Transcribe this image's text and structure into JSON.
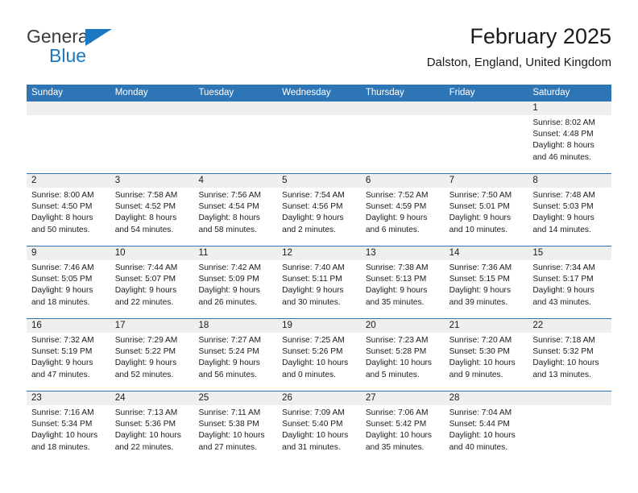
{
  "brand": {
    "line1": "General",
    "line2": "Blue",
    "triangle_color": "#1a78c2"
  },
  "header": {
    "title": "February 2025",
    "subtitle": "Dalston, England, United Kingdom"
  },
  "colors": {
    "header_blue": "#2e75b6",
    "day_band_gray": "#efefef",
    "text": "#1b1b1b"
  },
  "weekdays": [
    "Sunday",
    "Monday",
    "Tuesday",
    "Wednesday",
    "Thursday",
    "Friday",
    "Saturday"
  ],
  "weeks": [
    [
      {
        "day": "",
        "empty": true
      },
      {
        "day": "",
        "empty": true
      },
      {
        "day": "",
        "empty": true
      },
      {
        "day": "",
        "empty": true
      },
      {
        "day": "",
        "empty": true
      },
      {
        "day": "",
        "empty": true
      },
      {
        "day": "1",
        "sunrise": "Sunrise: 8:02 AM",
        "sunset": "Sunset: 4:48 PM",
        "daylight": "Daylight: 8 hours and 46 minutes."
      }
    ],
    [
      {
        "day": "2",
        "sunrise": "Sunrise: 8:00 AM",
        "sunset": "Sunset: 4:50 PM",
        "daylight": "Daylight: 8 hours and 50 minutes."
      },
      {
        "day": "3",
        "sunrise": "Sunrise: 7:58 AM",
        "sunset": "Sunset: 4:52 PM",
        "daylight": "Daylight: 8 hours and 54 minutes."
      },
      {
        "day": "4",
        "sunrise": "Sunrise: 7:56 AM",
        "sunset": "Sunset: 4:54 PM",
        "daylight": "Daylight: 8 hours and 58 minutes."
      },
      {
        "day": "5",
        "sunrise": "Sunrise: 7:54 AM",
        "sunset": "Sunset: 4:56 PM",
        "daylight": "Daylight: 9 hours and 2 minutes."
      },
      {
        "day": "6",
        "sunrise": "Sunrise: 7:52 AM",
        "sunset": "Sunset: 4:59 PM",
        "daylight": "Daylight: 9 hours and 6 minutes."
      },
      {
        "day": "7",
        "sunrise": "Sunrise: 7:50 AM",
        "sunset": "Sunset: 5:01 PM",
        "daylight": "Daylight: 9 hours and 10 minutes."
      },
      {
        "day": "8",
        "sunrise": "Sunrise: 7:48 AM",
        "sunset": "Sunset: 5:03 PM",
        "daylight": "Daylight: 9 hours and 14 minutes."
      }
    ],
    [
      {
        "day": "9",
        "sunrise": "Sunrise: 7:46 AM",
        "sunset": "Sunset: 5:05 PM",
        "daylight": "Daylight: 9 hours and 18 minutes."
      },
      {
        "day": "10",
        "sunrise": "Sunrise: 7:44 AM",
        "sunset": "Sunset: 5:07 PM",
        "daylight": "Daylight: 9 hours and 22 minutes."
      },
      {
        "day": "11",
        "sunrise": "Sunrise: 7:42 AM",
        "sunset": "Sunset: 5:09 PM",
        "daylight": "Daylight: 9 hours and 26 minutes."
      },
      {
        "day": "12",
        "sunrise": "Sunrise: 7:40 AM",
        "sunset": "Sunset: 5:11 PM",
        "daylight": "Daylight: 9 hours and 30 minutes."
      },
      {
        "day": "13",
        "sunrise": "Sunrise: 7:38 AM",
        "sunset": "Sunset: 5:13 PM",
        "daylight": "Daylight: 9 hours and 35 minutes."
      },
      {
        "day": "14",
        "sunrise": "Sunrise: 7:36 AM",
        "sunset": "Sunset: 5:15 PM",
        "daylight": "Daylight: 9 hours and 39 minutes."
      },
      {
        "day": "15",
        "sunrise": "Sunrise: 7:34 AM",
        "sunset": "Sunset: 5:17 PM",
        "daylight": "Daylight: 9 hours and 43 minutes."
      }
    ],
    [
      {
        "day": "16",
        "sunrise": "Sunrise: 7:32 AM",
        "sunset": "Sunset: 5:19 PM",
        "daylight": "Daylight: 9 hours and 47 minutes."
      },
      {
        "day": "17",
        "sunrise": "Sunrise: 7:29 AM",
        "sunset": "Sunset: 5:22 PM",
        "daylight": "Daylight: 9 hours and 52 minutes."
      },
      {
        "day": "18",
        "sunrise": "Sunrise: 7:27 AM",
        "sunset": "Sunset: 5:24 PM",
        "daylight": "Daylight: 9 hours and 56 minutes."
      },
      {
        "day": "19",
        "sunrise": "Sunrise: 7:25 AM",
        "sunset": "Sunset: 5:26 PM",
        "daylight": "Daylight: 10 hours and 0 minutes."
      },
      {
        "day": "20",
        "sunrise": "Sunrise: 7:23 AM",
        "sunset": "Sunset: 5:28 PM",
        "daylight": "Daylight: 10 hours and 5 minutes."
      },
      {
        "day": "21",
        "sunrise": "Sunrise: 7:20 AM",
        "sunset": "Sunset: 5:30 PM",
        "daylight": "Daylight: 10 hours and 9 minutes."
      },
      {
        "day": "22",
        "sunrise": "Sunrise: 7:18 AM",
        "sunset": "Sunset: 5:32 PM",
        "daylight": "Daylight: 10 hours and 13 minutes."
      }
    ],
    [
      {
        "day": "23",
        "sunrise": "Sunrise: 7:16 AM",
        "sunset": "Sunset: 5:34 PM",
        "daylight": "Daylight: 10 hours and 18 minutes."
      },
      {
        "day": "24",
        "sunrise": "Sunrise: 7:13 AM",
        "sunset": "Sunset: 5:36 PM",
        "daylight": "Daylight: 10 hours and 22 minutes."
      },
      {
        "day": "25",
        "sunrise": "Sunrise: 7:11 AM",
        "sunset": "Sunset: 5:38 PM",
        "daylight": "Daylight: 10 hours and 27 minutes."
      },
      {
        "day": "26",
        "sunrise": "Sunrise: 7:09 AM",
        "sunset": "Sunset: 5:40 PM",
        "daylight": "Daylight: 10 hours and 31 minutes."
      },
      {
        "day": "27",
        "sunrise": "Sunrise: 7:06 AM",
        "sunset": "Sunset: 5:42 PM",
        "daylight": "Daylight: 10 hours and 35 minutes."
      },
      {
        "day": "28",
        "sunrise": "Sunrise: 7:04 AM",
        "sunset": "Sunset: 5:44 PM",
        "daylight": "Daylight: 10 hours and 40 minutes."
      },
      {
        "day": "",
        "empty": true
      }
    ]
  ]
}
